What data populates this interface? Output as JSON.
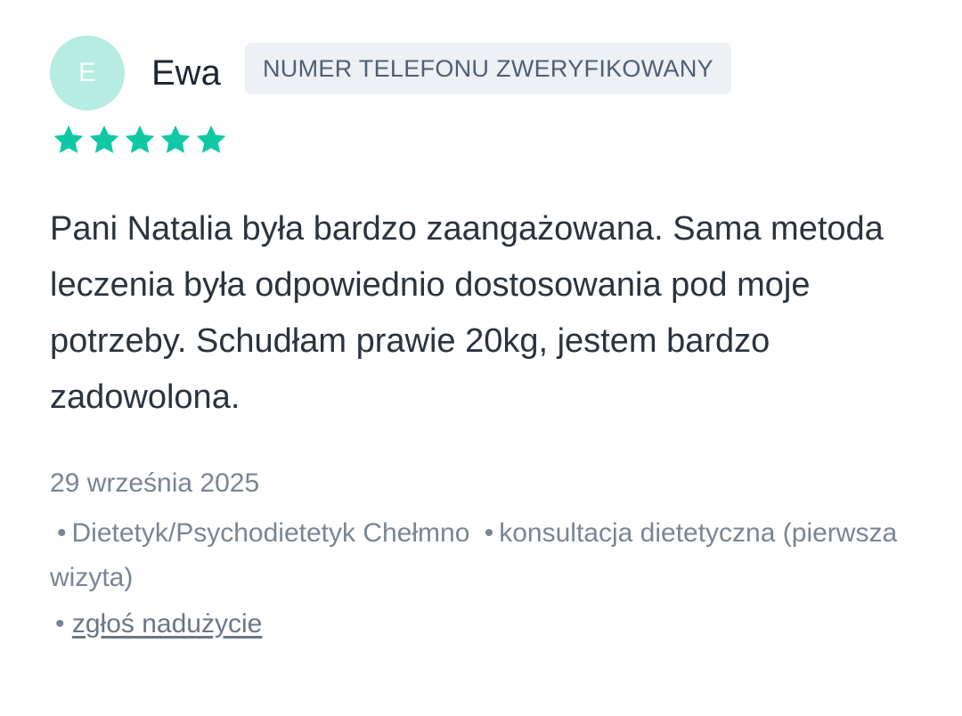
{
  "review": {
    "author": {
      "initial": "E",
      "name": "Ewa",
      "avatar_color": "#b7ece2"
    },
    "verified_badge": "NUMER TELEFONU ZWERYFIKOWANY",
    "rating": {
      "value": 5,
      "max": 5,
      "star_icon": "star-icon",
      "color": "#0fc9a6"
    },
    "text": "Pani Natalia była bardzo zaangażowana. Sama metoda leczenia była odpowiednio dostosowania pod moje potrzeby. Schudłam prawie 20kg, jestem bardzo zadowolona.",
    "date": "29 września 2025",
    "separator": "•",
    "specialty": "Dietetyk/Psychodietetyk Chełmno",
    "service": "konsultacja dietetyczna (pierwsza wizyta)",
    "report_link": "zgłoś nadużycie"
  }
}
